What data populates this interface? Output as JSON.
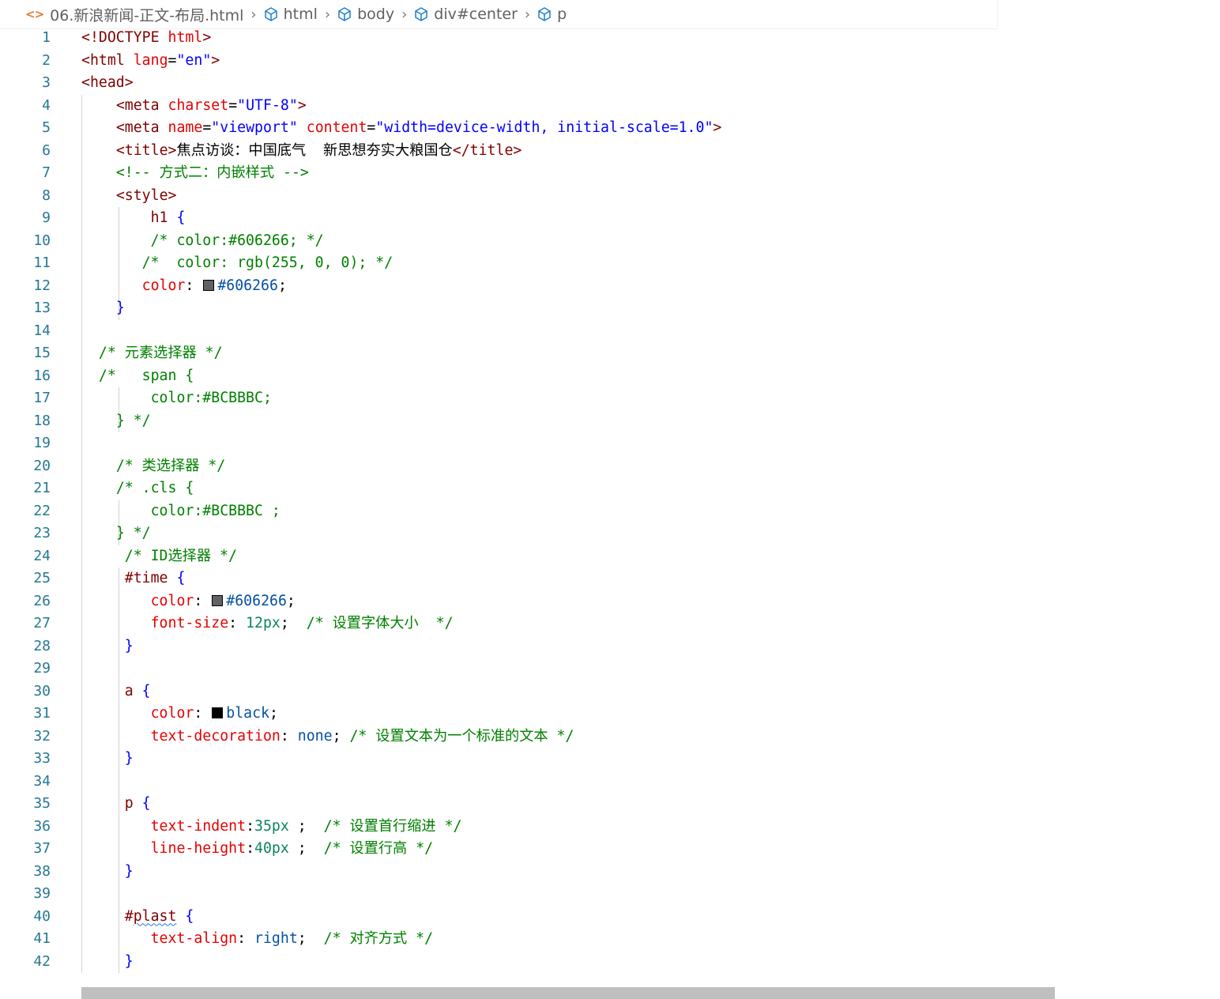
{
  "breadcrumb": {
    "file_name": "06.新浪新闻-正文-布局.html",
    "segments": [
      "html",
      "body",
      "div#center",
      "p"
    ]
  },
  "icons": {
    "file": "code-file-icon",
    "element": "cube-icon"
  },
  "colors": {
    "line_number": "#237893",
    "tag": "#800000",
    "attribute": "#e50000",
    "string": "#0000ff",
    "comment": "#008000",
    "value": "#0451a5",
    "number": "#098658",
    "swatch_gray": "#606266",
    "swatch_black": "#000000"
  },
  "editor": {
    "lines": [
      {
        "n": "1",
        "tokens": [
          [
            "t-punc",
            "<!"
          ],
          [
            "t-tag",
            "DOCTYPE"
          ],
          [
            "t-plain",
            " "
          ],
          [
            "t-attr",
            "html"
          ],
          [
            "t-punc",
            ">"
          ]
        ]
      },
      {
        "n": "2",
        "tokens": [
          [
            "t-punc",
            "<"
          ],
          [
            "t-tag",
            "html"
          ],
          [
            "t-plain",
            " "
          ],
          [
            "t-attr",
            "lang"
          ],
          [
            "t-plain",
            "="
          ],
          [
            "t-str",
            "\"en\""
          ],
          [
            "t-punc",
            ">"
          ]
        ]
      },
      {
        "n": "3",
        "tokens": [
          [
            "t-punc",
            "<"
          ],
          [
            "t-tag",
            "head"
          ],
          [
            "t-punc",
            ">"
          ]
        ]
      },
      {
        "n": "4",
        "tokens": [
          [
            "t-plain",
            "    "
          ],
          [
            "t-punc",
            "<"
          ],
          [
            "t-tag",
            "meta"
          ],
          [
            "t-plain",
            " "
          ],
          [
            "t-attr",
            "charset"
          ],
          [
            "t-plain",
            "="
          ],
          [
            "t-str",
            "\"UTF-8\""
          ],
          [
            "t-punc",
            ">"
          ]
        ]
      },
      {
        "n": "5",
        "tokens": [
          [
            "t-plain",
            "    "
          ],
          [
            "t-punc",
            "<"
          ],
          [
            "t-tag",
            "meta"
          ],
          [
            "t-plain",
            " "
          ],
          [
            "t-attr",
            "name"
          ],
          [
            "t-plain",
            "="
          ],
          [
            "t-str",
            "\"viewport\""
          ],
          [
            "t-plain",
            " "
          ],
          [
            "t-attr",
            "content"
          ],
          [
            "t-plain",
            "="
          ],
          [
            "t-str",
            "\"width=device-width, initial-scale=1.0\""
          ],
          [
            "t-punc",
            ">"
          ]
        ]
      },
      {
        "n": "6",
        "tokens": [
          [
            "t-plain",
            "    "
          ],
          [
            "t-punc",
            "<"
          ],
          [
            "t-tag",
            "title"
          ],
          [
            "t-punc",
            ">"
          ],
          [
            "t-text",
            "焦点访谈：中国底气  新思想夯实大粮国仓"
          ],
          [
            "t-punc",
            "</"
          ],
          [
            "t-tag",
            "title"
          ],
          [
            "t-punc",
            ">"
          ]
        ]
      },
      {
        "n": "7",
        "tokens": [
          [
            "t-plain",
            "    "
          ],
          [
            "t-com",
            "<!-- 方式二：内嵌样式 -->"
          ]
        ]
      },
      {
        "n": "8",
        "tokens": [
          [
            "t-plain",
            "    "
          ],
          [
            "t-punc",
            "<"
          ],
          [
            "t-tag",
            "style"
          ],
          [
            "t-punc",
            ">"
          ]
        ]
      },
      {
        "n": "9",
        "tokens": [
          [
            "t-plain",
            "        "
          ],
          [
            "t-sel",
            "h1"
          ],
          [
            "t-plain",
            " "
          ],
          [
            "t-brace",
            "{"
          ]
        ]
      },
      {
        "n": "10",
        "tokens": [
          [
            "t-plain",
            "        "
          ],
          [
            "t-com",
            "/* color:#606266; */"
          ]
        ]
      },
      {
        "n": "11",
        "tokens": [
          [
            "t-plain",
            "       "
          ],
          [
            "t-com",
            "/*  color: rgb(255, 0, 0); */"
          ]
        ]
      },
      {
        "n": "12",
        "tokens": [
          [
            "t-plain",
            "       "
          ],
          [
            "t-prop",
            "color"
          ],
          [
            "t-plain",
            ": "
          ],
          [
            "swatch",
            "#606266"
          ],
          [
            "t-val",
            "#606266"
          ],
          [
            "t-plain",
            ";"
          ]
        ]
      },
      {
        "n": "13",
        "tokens": [
          [
            "t-plain",
            "    "
          ],
          [
            "t-brace",
            "}"
          ]
        ]
      },
      {
        "n": "14",
        "tokens": []
      },
      {
        "n": "15",
        "tokens": [
          [
            "t-plain",
            "  "
          ],
          [
            "t-com",
            "/* 元素选择器 */"
          ]
        ]
      },
      {
        "n": "16",
        "tokens": [
          [
            "t-plain",
            "  "
          ],
          [
            "t-com",
            "/*   span {"
          ]
        ]
      },
      {
        "n": "17",
        "tokens": [
          [
            "t-plain",
            "        "
          ],
          [
            "t-com",
            "color:#BCBBBC;"
          ]
        ]
      },
      {
        "n": "18",
        "tokens": [
          [
            "t-plain",
            "    "
          ],
          [
            "t-com",
            "} */"
          ]
        ]
      },
      {
        "n": "19",
        "tokens": []
      },
      {
        "n": "20",
        "tokens": [
          [
            "t-plain",
            "    "
          ],
          [
            "t-com",
            "/* 类选择器 */"
          ]
        ]
      },
      {
        "n": "21",
        "tokens": [
          [
            "t-plain",
            "    "
          ],
          [
            "t-com",
            "/* .cls {"
          ]
        ]
      },
      {
        "n": "22",
        "tokens": [
          [
            "t-plain",
            "        "
          ],
          [
            "t-com",
            "color:#BCBBBC ;"
          ]
        ]
      },
      {
        "n": "23",
        "tokens": [
          [
            "t-plain",
            "    "
          ],
          [
            "t-com",
            "} */"
          ]
        ]
      },
      {
        "n": "24",
        "tokens": [
          [
            "t-plain",
            "     "
          ],
          [
            "t-com",
            "/* ID选择器 */"
          ]
        ]
      },
      {
        "n": "25",
        "tokens": [
          [
            "t-plain",
            "     "
          ],
          [
            "t-sel",
            "#time"
          ],
          [
            "t-plain",
            " "
          ],
          [
            "t-brace",
            "{"
          ]
        ]
      },
      {
        "n": "26",
        "tokens": [
          [
            "t-plain",
            "        "
          ],
          [
            "t-prop",
            "color"
          ],
          [
            "t-plain",
            ": "
          ],
          [
            "swatch",
            "#606266"
          ],
          [
            "t-val",
            "#606266"
          ],
          [
            "t-plain",
            ";"
          ]
        ]
      },
      {
        "n": "27",
        "tokens": [
          [
            "t-plain",
            "        "
          ],
          [
            "t-prop",
            "font-size"
          ],
          [
            "t-plain",
            ": "
          ],
          [
            "t-num",
            "12px"
          ],
          [
            "t-plain",
            ";  "
          ],
          [
            "t-com",
            "/* 设置字体大小  */"
          ]
        ]
      },
      {
        "n": "28",
        "tokens": [
          [
            "t-plain",
            "     "
          ],
          [
            "t-brace",
            "}"
          ]
        ]
      },
      {
        "n": "29",
        "tokens": []
      },
      {
        "n": "30",
        "tokens": [
          [
            "t-plain",
            "     "
          ],
          [
            "t-sel",
            "a"
          ],
          [
            "t-plain",
            " "
          ],
          [
            "t-brace",
            "{"
          ]
        ]
      },
      {
        "n": "31",
        "tokens": [
          [
            "t-plain",
            "        "
          ],
          [
            "t-prop",
            "color"
          ],
          [
            "t-plain",
            ": "
          ],
          [
            "swatch",
            "#000000"
          ],
          [
            "t-val",
            "black"
          ],
          [
            "t-plain",
            ";"
          ]
        ]
      },
      {
        "n": "32",
        "tokens": [
          [
            "t-plain",
            "        "
          ],
          [
            "t-prop",
            "text-decoration"
          ],
          [
            "t-plain",
            ": "
          ],
          [
            "t-val",
            "none"
          ],
          [
            "t-plain",
            "; "
          ],
          [
            "t-com",
            "/* 设置文本为一个标准的文本 */"
          ]
        ]
      },
      {
        "n": "33",
        "tokens": [
          [
            "t-plain",
            "     "
          ],
          [
            "t-brace",
            "}"
          ]
        ]
      },
      {
        "n": "34",
        "tokens": []
      },
      {
        "n": "35",
        "tokens": [
          [
            "t-plain",
            "     "
          ],
          [
            "t-sel",
            "p"
          ],
          [
            "t-plain",
            " "
          ],
          [
            "t-brace",
            "{"
          ]
        ]
      },
      {
        "n": "36",
        "tokens": [
          [
            "t-plain",
            "        "
          ],
          [
            "t-prop",
            "text-indent"
          ],
          [
            "t-plain",
            ":"
          ],
          [
            "t-num",
            "35px"
          ],
          [
            "t-plain",
            " ;  "
          ],
          [
            "t-com",
            "/* 设置首行缩进 */"
          ]
        ]
      },
      {
        "n": "37",
        "tokens": [
          [
            "t-plain",
            "        "
          ],
          [
            "t-prop",
            "line-height"
          ],
          [
            "t-plain",
            ":"
          ],
          [
            "t-num",
            "40px"
          ],
          [
            "t-plain",
            " ;  "
          ],
          [
            "t-com",
            "/* 设置行高 */"
          ]
        ]
      },
      {
        "n": "38",
        "tokens": [
          [
            "t-plain",
            "     "
          ],
          [
            "t-brace",
            "}"
          ]
        ]
      },
      {
        "n": "39",
        "tokens": []
      },
      {
        "n": "40",
        "tokens": [
          [
            "t-plain",
            "     "
          ],
          [
            "t-sel",
            "#"
          ],
          [
            "squiggle",
            "plast"
          ],
          [
            "t-plain",
            " "
          ],
          [
            "t-brace",
            "{"
          ]
        ]
      },
      {
        "n": "41",
        "tokens": [
          [
            "t-plain",
            "        "
          ],
          [
            "t-prop",
            "text-align"
          ],
          [
            "t-plain",
            ": "
          ],
          [
            "t-val",
            "right"
          ],
          [
            "t-plain",
            ";  "
          ],
          [
            "t-com",
            "/* 对齐方式 */"
          ]
        ]
      },
      {
        "n": "42",
        "tokens": [
          [
            "t-plain",
            "     "
          ],
          [
            "t-brace",
            "}"
          ]
        ]
      }
    ]
  }
}
